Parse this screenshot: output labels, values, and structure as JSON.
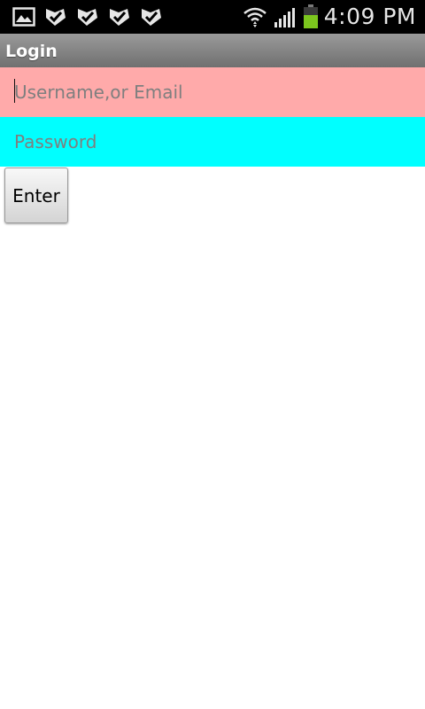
{
  "status_bar": {
    "time": "4:09 PM",
    "icons": [
      "gallery-icon",
      "check-notification-icon",
      "check-notification-icon",
      "check-notification-icon",
      "check-notification-icon",
      "wifi-icon",
      "signal-icon",
      "battery-icon"
    ],
    "battery_color": "#7cc61e"
  },
  "title_bar": {
    "title": "Login"
  },
  "form": {
    "username_placeholder": "Username,or Email",
    "username_value": "",
    "username_bg": "#ffaaaa",
    "password_placeholder": "Password",
    "password_value": "",
    "password_bg": "#00ffff",
    "enter_label": "Enter"
  }
}
